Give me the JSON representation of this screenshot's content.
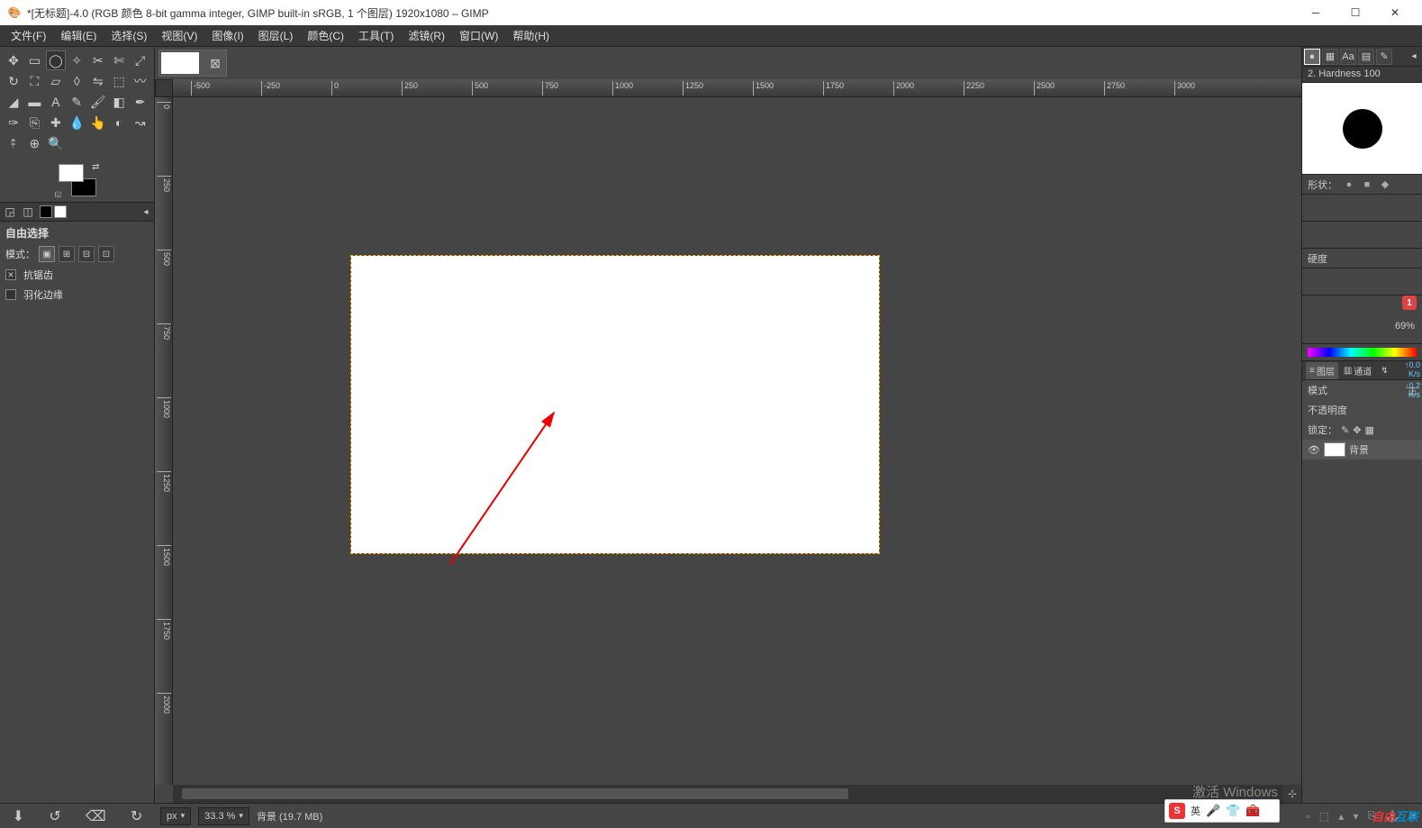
{
  "title": "*[无标题]-4.0 (RGB 颜色 8-bit gamma integer, GIMP built-in sRGB, 1 个图层) 1920x1080 – GIMP",
  "menu": [
    "文件(F)",
    "编辑(E)",
    "选择(S)",
    "视图(V)",
    "图像(I)",
    "图层(L)",
    "颜色(C)",
    "工具(T)",
    "滤镜(R)",
    "窗口(W)",
    "帮助(H)"
  ],
  "tool_options": {
    "title": "自由选择",
    "mode_label": "模式：",
    "antialias": "抗锯齿",
    "feather": "羽化边缘"
  },
  "ruler_h": [
    "-500",
    "-250",
    "0",
    "250",
    "500",
    "750",
    "1000",
    "1250",
    "1500",
    "1750",
    "2000",
    "2250",
    "2500",
    "2750",
    "3000"
  ],
  "ruler_v": [
    "0",
    "250",
    "500",
    "750",
    "1000",
    "1250",
    "1500",
    "1750",
    "2000"
  ],
  "status": {
    "unit": "px",
    "zoom": "33.3 %",
    "layer": "背景 (19.7 MB)"
  },
  "brush": {
    "name": "2. Hardness 100",
    "shape_label": "形状：",
    "hardness_label": "硬度",
    "percent": "69",
    "percent_suffix": "%",
    "warning": "1"
  },
  "layers": {
    "tab_layers": "图层",
    "tab_channels": "通道",
    "mode_label": "模式",
    "opacity_label": "不透明度",
    "lock_label": "锁定：",
    "bg_layer": "背景",
    "net_up": "0.0",
    "net_dn": "0.2",
    "net_unit": "K/s"
  },
  "watermark": "激活 Windows",
  "ime": {
    "lang": "英"
  },
  "brand": {
    "a": "自由",
    "b": "互联"
  }
}
